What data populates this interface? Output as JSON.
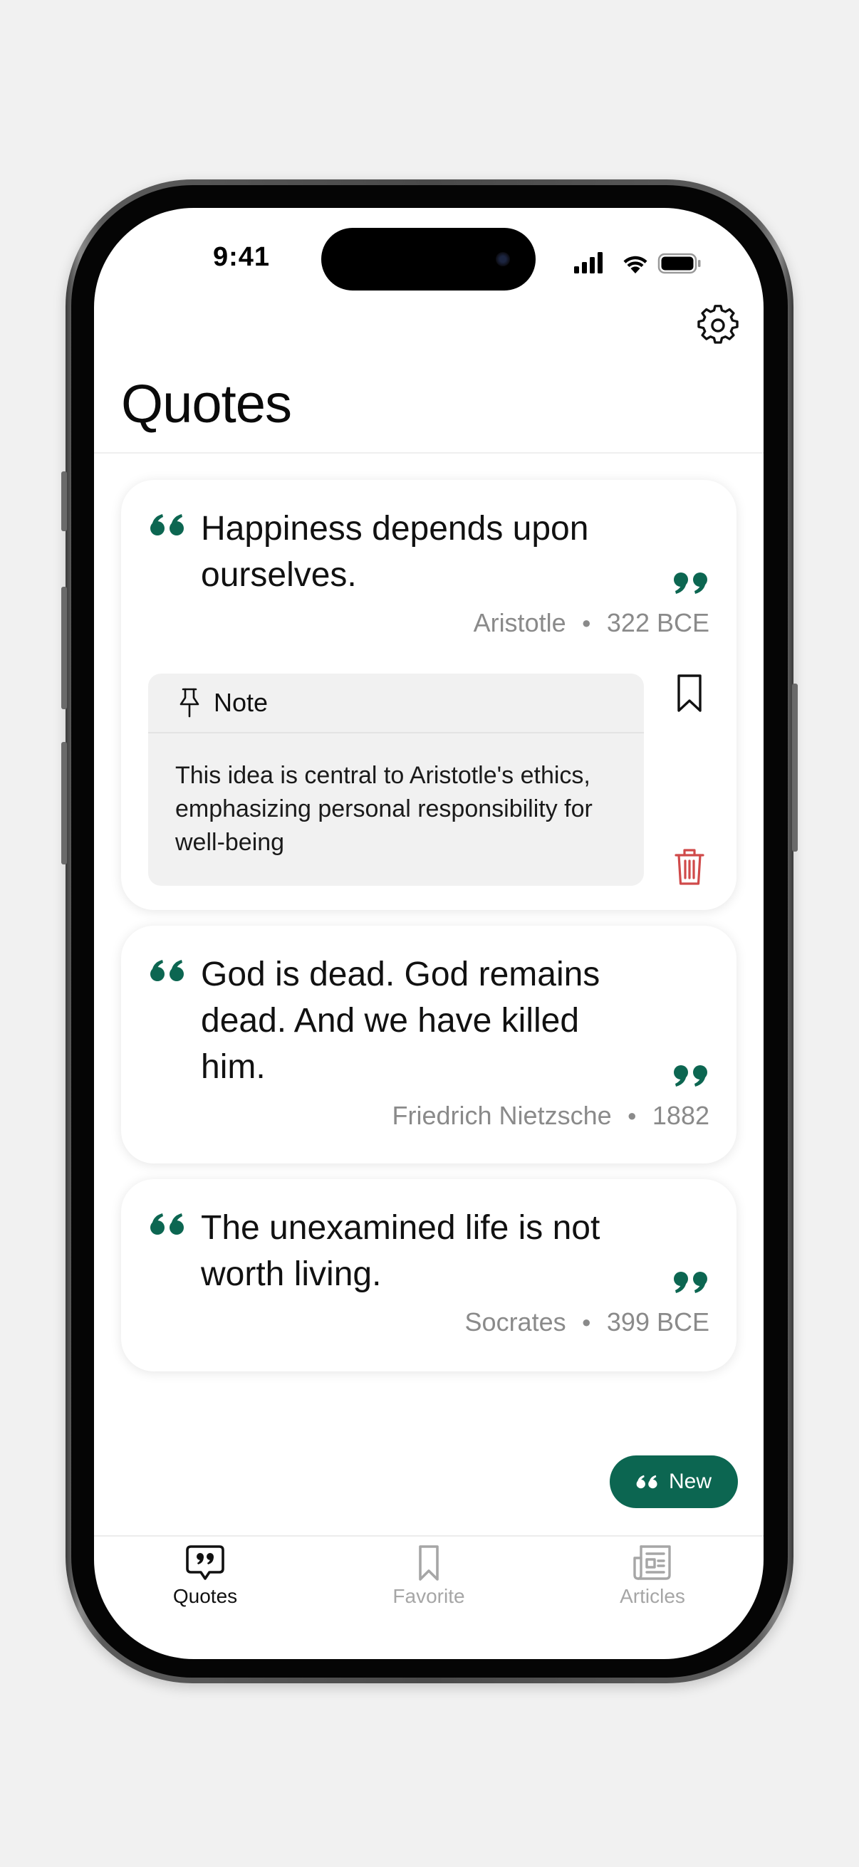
{
  "status_bar": {
    "time": "9:41"
  },
  "header": {
    "title": "Quotes",
    "settings_icon": "gear-icon"
  },
  "quotes": [
    {
      "text": "Happiness depends upon ourselves.",
      "author": "Aristotle",
      "date": "322 BCE",
      "note": {
        "label": "Note",
        "text": "This idea is central to Aristotle's ethics, emphasizing personal responsibility for well-being"
      }
    },
    {
      "text": "God is dead. God remains dead. And we have killed him.",
      "author": "Friedrich Nietzsche",
      "date": "1882"
    },
    {
      "text": "The unexamined life is not worth living.",
      "author": "Socrates",
      "date": "399 BCE"
    }
  ],
  "fab": {
    "label": "New",
    "icon": "quote-icon"
  },
  "tabs": [
    {
      "label": "Quotes",
      "icon": "quote-bubble-icon",
      "active": true
    },
    {
      "label": "Favorite",
      "icon": "bookmark-icon",
      "active": false
    },
    {
      "label": "Articles",
      "icon": "newspaper-icon",
      "active": false
    }
  ],
  "colors": {
    "accent": "#0c6651",
    "delete": "#d04a4a",
    "muted_text": "#8a8a8a",
    "inactive_tab": "#a6a6a6"
  }
}
